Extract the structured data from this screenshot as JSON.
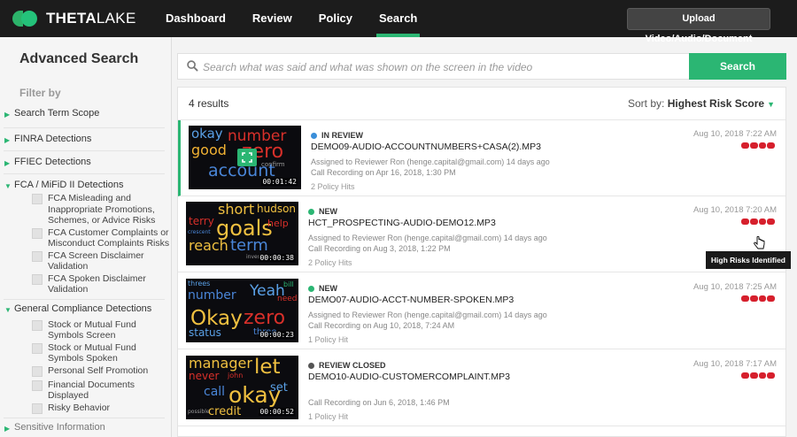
{
  "brand": {
    "name_bold": "THETA",
    "name_light": "LAKE"
  },
  "nav": [
    "Dashboard",
    "Review",
    "Policy",
    "Search"
  ],
  "active_nav": "Search",
  "upload_label": "Upload Video/Audio/Document",
  "sidebar": {
    "title": "Advanced Search",
    "filter_by": "Filter by",
    "sections": [
      {
        "label": "Search Term Scope",
        "expanded": false
      },
      {
        "label": "FINRA Detections",
        "expanded": false
      },
      {
        "label": "FFIEC Detections",
        "expanded": false
      },
      {
        "label": "FCA / MiFiD II Detections",
        "expanded": true,
        "items": [
          "FCA Misleading and Inappropriate Promotions, Schemes, or Advice Risks",
          "FCA Customer Complaints or Misconduct Complaints Risks",
          "FCA Screen Disclaimer Validation",
          "FCA Spoken Disclaimer Validation"
        ]
      },
      {
        "label": "General Compliance Detections",
        "expanded": true,
        "items": [
          "Stock or Mutual Fund Symbols Screen",
          "Stock or Mutual Fund Symbols Spoken",
          "Personal Self Promotion",
          "Financial Documents Displayed",
          "Risky Behavior"
        ]
      },
      {
        "label": "Sensitive Information",
        "expanded": false
      }
    ]
  },
  "search": {
    "placeholder": "Search what was said and what was shown on the screen in the video",
    "button": "Search"
  },
  "results_count": "4 results",
  "sort": {
    "label": "Sort by:",
    "value": "Highest Risk Score"
  },
  "results": [
    {
      "status": "IN REVIEW",
      "status_color": "#3b8fd9",
      "file": "DEMO09-AUDIO-ACCOUNTNUMBERS+CASA(2).MP3",
      "assigned": "Assigned to Reviewer Ron (henge.capital@gmail.com) 14 days ago",
      "recording": "Call Recording on Apr 16, 2018, 1:30 PM",
      "hits": "2 Policy Hits",
      "date": "Aug 10, 2018 7:22 AM",
      "timestamp": "00:01:42"
    },
    {
      "status": "NEW",
      "status_color": "#2bb673",
      "file": "HCT_PROSPECTING-AUDIO-DEMO12.MP3",
      "assigned": "Assigned to Reviewer Ron (henge.capital@gmail.com) 14 days ago",
      "recording": "Call Recording on Aug 3, 2018, 1:22 PM",
      "hits": "2 Policy Hits",
      "date": "Aug 10, 2018 7:20 AM",
      "timestamp": "00:00:38"
    },
    {
      "status": "NEW",
      "status_color": "#2bb673",
      "file": "DEMO07-AUDIO-ACCT-NUMBER-SPOKEN.MP3",
      "assigned": "Assigned to Reviewer Ron (henge.capital@gmail.com) 14 days ago",
      "recording": "Call Recording on Aug 10, 2018, 7:24 AM",
      "hits": "1 Policy Hit",
      "date": "Aug 10, 2018 7:25 AM",
      "timestamp": "00:00:23"
    },
    {
      "status": "REVIEW CLOSED",
      "status_color": "#555555",
      "file": "DEMO10-AUDIO-CUSTOMERCOMPLAINT.MP3",
      "assigned": "",
      "recording": "Call Recording on Jun 6, 2018, 1:46 PM",
      "hits": "1 Policy Hit",
      "date": "Aug 10, 2018 7:17 AM",
      "timestamp": "00:00:52"
    }
  ],
  "wordclouds": [
    [
      {
        "t": "okay",
        "c": "#5aa0e6"
      },
      {
        "t": "number",
        "c": "#d8302a"
      },
      {
        "t": "good",
        "c": "#f2b233"
      },
      {
        "t": "zero",
        "c": "#d8302a"
      },
      {
        "t": "account",
        "c": "#4a86d8"
      },
      {
        "t": "confirm",
        "c": "#9a9a9a"
      }
    ],
    [
      {
        "t": "short",
        "c": "#f0c040"
      },
      {
        "t": "hudson",
        "c": "#f0c040"
      },
      {
        "t": "terry",
        "c": "#d8302a"
      },
      {
        "t": "goals",
        "c": "#f0c040"
      },
      {
        "t": "help",
        "c": "#d8302a"
      },
      {
        "t": "reach",
        "c": "#f0c040"
      },
      {
        "t": "term",
        "c": "#4a86d8"
      },
      {
        "t": "crescent",
        "c": "#4a86d8"
      },
      {
        "t": "investment",
        "c": "#9a9a9a"
      }
    ],
    [
      {
        "t": "threes",
        "c": "#5aa0e6"
      },
      {
        "t": "number",
        "c": "#4a86d8"
      },
      {
        "t": "Yeah",
        "c": "#5aa0e6"
      },
      {
        "t": "bill",
        "c": "#2bb673"
      },
      {
        "t": "need",
        "c": "#d8302a"
      },
      {
        "t": "Okay",
        "c": "#f0c040"
      },
      {
        "t": "zero",
        "c": "#d8302a"
      },
      {
        "t": "status",
        "c": "#5aa0e6"
      },
      {
        "t": "three",
        "c": "#4a86d8"
      }
    ],
    [
      {
        "t": "manager",
        "c": "#f0c040"
      },
      {
        "t": "let",
        "c": "#f0c040"
      },
      {
        "t": "never",
        "c": "#d8302a"
      },
      {
        "t": "john",
        "c": "#d8302a"
      },
      {
        "t": "set",
        "c": "#5aa0e6"
      },
      {
        "t": "call",
        "c": "#4a86d8"
      },
      {
        "t": "okay",
        "c": "#f0c040"
      },
      {
        "t": "credit",
        "c": "#f0c040"
      },
      {
        "t": "possible",
        "c": "#9a9a9a"
      }
    ]
  ],
  "tooltip": "High Risks Identified",
  "colors": {
    "accent": "#2bb673",
    "risk": "#d61f2c",
    "topbar": "#1c1c1c"
  }
}
